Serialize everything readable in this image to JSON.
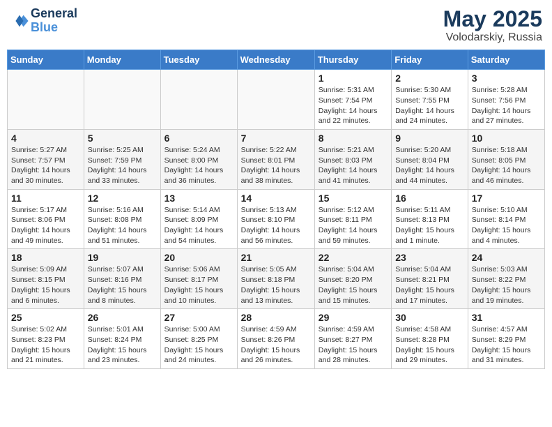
{
  "header": {
    "logo_line1": "General",
    "logo_line2": "Blue",
    "month_year": "May 2025",
    "location": "Volodarskiy, Russia"
  },
  "weekdays": [
    "Sunday",
    "Monday",
    "Tuesday",
    "Wednesday",
    "Thursday",
    "Friday",
    "Saturday"
  ],
  "weeks": [
    [
      {
        "day": "",
        "info": ""
      },
      {
        "day": "",
        "info": ""
      },
      {
        "day": "",
        "info": ""
      },
      {
        "day": "",
        "info": ""
      },
      {
        "day": "1",
        "info": "Sunrise: 5:31 AM\nSunset: 7:54 PM\nDaylight: 14 hours\nand 22 minutes."
      },
      {
        "day": "2",
        "info": "Sunrise: 5:30 AM\nSunset: 7:55 PM\nDaylight: 14 hours\nand 24 minutes."
      },
      {
        "day": "3",
        "info": "Sunrise: 5:28 AM\nSunset: 7:56 PM\nDaylight: 14 hours\nand 27 minutes."
      }
    ],
    [
      {
        "day": "4",
        "info": "Sunrise: 5:27 AM\nSunset: 7:57 PM\nDaylight: 14 hours\nand 30 minutes."
      },
      {
        "day": "5",
        "info": "Sunrise: 5:25 AM\nSunset: 7:59 PM\nDaylight: 14 hours\nand 33 minutes."
      },
      {
        "day": "6",
        "info": "Sunrise: 5:24 AM\nSunset: 8:00 PM\nDaylight: 14 hours\nand 36 minutes."
      },
      {
        "day": "7",
        "info": "Sunrise: 5:22 AM\nSunset: 8:01 PM\nDaylight: 14 hours\nand 38 minutes."
      },
      {
        "day": "8",
        "info": "Sunrise: 5:21 AM\nSunset: 8:03 PM\nDaylight: 14 hours\nand 41 minutes."
      },
      {
        "day": "9",
        "info": "Sunrise: 5:20 AM\nSunset: 8:04 PM\nDaylight: 14 hours\nand 44 minutes."
      },
      {
        "day": "10",
        "info": "Sunrise: 5:18 AM\nSunset: 8:05 PM\nDaylight: 14 hours\nand 46 minutes."
      }
    ],
    [
      {
        "day": "11",
        "info": "Sunrise: 5:17 AM\nSunset: 8:06 PM\nDaylight: 14 hours\nand 49 minutes."
      },
      {
        "day": "12",
        "info": "Sunrise: 5:16 AM\nSunset: 8:08 PM\nDaylight: 14 hours\nand 51 minutes."
      },
      {
        "day": "13",
        "info": "Sunrise: 5:14 AM\nSunset: 8:09 PM\nDaylight: 14 hours\nand 54 minutes."
      },
      {
        "day": "14",
        "info": "Sunrise: 5:13 AM\nSunset: 8:10 PM\nDaylight: 14 hours\nand 56 minutes."
      },
      {
        "day": "15",
        "info": "Sunrise: 5:12 AM\nSunset: 8:11 PM\nDaylight: 14 hours\nand 59 minutes."
      },
      {
        "day": "16",
        "info": "Sunrise: 5:11 AM\nSunset: 8:13 PM\nDaylight: 15 hours\nand 1 minute."
      },
      {
        "day": "17",
        "info": "Sunrise: 5:10 AM\nSunset: 8:14 PM\nDaylight: 15 hours\nand 4 minutes."
      }
    ],
    [
      {
        "day": "18",
        "info": "Sunrise: 5:09 AM\nSunset: 8:15 PM\nDaylight: 15 hours\nand 6 minutes."
      },
      {
        "day": "19",
        "info": "Sunrise: 5:07 AM\nSunset: 8:16 PM\nDaylight: 15 hours\nand 8 minutes."
      },
      {
        "day": "20",
        "info": "Sunrise: 5:06 AM\nSunset: 8:17 PM\nDaylight: 15 hours\nand 10 minutes."
      },
      {
        "day": "21",
        "info": "Sunrise: 5:05 AM\nSunset: 8:18 PM\nDaylight: 15 hours\nand 13 minutes."
      },
      {
        "day": "22",
        "info": "Sunrise: 5:04 AM\nSunset: 8:20 PM\nDaylight: 15 hours\nand 15 minutes."
      },
      {
        "day": "23",
        "info": "Sunrise: 5:04 AM\nSunset: 8:21 PM\nDaylight: 15 hours\nand 17 minutes."
      },
      {
        "day": "24",
        "info": "Sunrise: 5:03 AM\nSunset: 8:22 PM\nDaylight: 15 hours\nand 19 minutes."
      }
    ],
    [
      {
        "day": "25",
        "info": "Sunrise: 5:02 AM\nSunset: 8:23 PM\nDaylight: 15 hours\nand 21 minutes."
      },
      {
        "day": "26",
        "info": "Sunrise: 5:01 AM\nSunset: 8:24 PM\nDaylight: 15 hours\nand 23 minutes."
      },
      {
        "day": "27",
        "info": "Sunrise: 5:00 AM\nSunset: 8:25 PM\nDaylight: 15 hours\nand 24 minutes."
      },
      {
        "day": "28",
        "info": "Sunrise: 4:59 AM\nSunset: 8:26 PM\nDaylight: 15 hours\nand 26 minutes."
      },
      {
        "day": "29",
        "info": "Sunrise: 4:59 AM\nSunset: 8:27 PM\nDaylight: 15 hours\nand 28 minutes."
      },
      {
        "day": "30",
        "info": "Sunrise: 4:58 AM\nSunset: 8:28 PM\nDaylight: 15 hours\nand 29 minutes."
      },
      {
        "day": "31",
        "info": "Sunrise: 4:57 AM\nSunset: 8:29 PM\nDaylight: 15 hours\nand 31 minutes."
      }
    ]
  ]
}
